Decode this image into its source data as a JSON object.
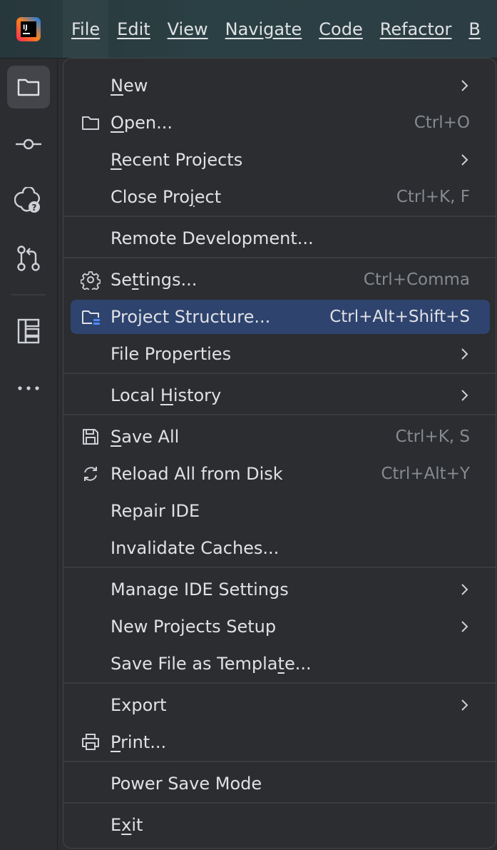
{
  "menubar": {
    "items": [
      {
        "label": "File",
        "active": true
      },
      {
        "label": "Edit"
      },
      {
        "label": "View"
      },
      {
        "label": "Navigate"
      },
      {
        "label": "Code"
      },
      {
        "label": "Refactor"
      },
      {
        "label": "B"
      }
    ]
  },
  "toolstrip": {
    "icons": [
      "project-folder-icon",
      "commit-icon",
      "ai-assistant-icon",
      "pull-requests-icon",
      "structure-icon",
      "more-icon"
    ]
  },
  "file_menu": {
    "items": [
      {
        "label": "New",
        "mnemonic_index": 0,
        "submenu": true
      },
      {
        "label": "Open...",
        "mnemonic_index": 0,
        "shortcut": "Ctrl+O",
        "icon": "folder-icon"
      },
      {
        "label": "Recent Projects",
        "mnemonic_index": 0,
        "submenu": true
      },
      {
        "label": "Close Project",
        "mnemonic_index": 9,
        "shortcut": "Ctrl+K, F"
      },
      {
        "label": "Remote Development..."
      },
      {
        "label": "Settings...",
        "mnemonic_index": 2,
        "shortcut": "Ctrl+Comma",
        "icon": "gear-icon"
      },
      {
        "label": "Project Structure...",
        "shortcut": "Ctrl+Alt+Shift+S",
        "icon": "project-structure-icon",
        "highlighted": true
      },
      {
        "label": "File Properties",
        "submenu": true
      },
      {
        "label": "Local History",
        "mnemonic_index": 6,
        "submenu": true
      },
      {
        "label": "Save All",
        "mnemonic_index": 0,
        "shortcut": "Ctrl+K, S",
        "icon": "save-icon"
      },
      {
        "label": "Reload All from Disk",
        "shortcut": "Ctrl+Alt+Y",
        "icon": "reload-icon"
      },
      {
        "label": "Repair IDE"
      },
      {
        "label": "Invalidate Caches..."
      },
      {
        "label": "Manage IDE Settings",
        "submenu": true
      },
      {
        "label": "New Projects Setup",
        "submenu": true
      },
      {
        "label": "Save File as Template...",
        "mnemonic_index": 19
      },
      {
        "label": "Export",
        "submenu": true
      },
      {
        "label": "Print...",
        "mnemonic_index": 0,
        "icon": "printer-icon"
      },
      {
        "label": "Power Save Mode"
      },
      {
        "label": "Exit",
        "mnemonic_index": 1
      }
    ]
  },
  "colors": {
    "highlight": "#2e436e",
    "text": "#dfe1e5",
    "shortcut": "#868a91",
    "separator": "#393b40",
    "menu_bg": "#2b2d30"
  }
}
